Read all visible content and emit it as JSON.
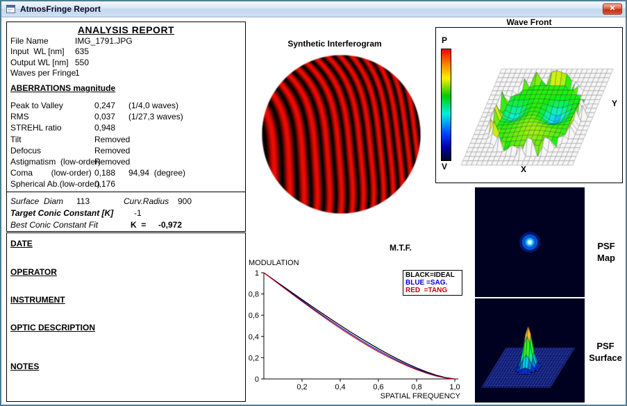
{
  "window": {
    "title": "AtmosFringe  Report",
    "close_glyph": "✕"
  },
  "report": {
    "title": "ANALYSIS  REPORT",
    "fields": [
      {
        "label": "File Name",
        "value": "IMG_1791.JPG"
      },
      {
        "label": "Input  WL [nm]",
        "value": "635"
      },
      {
        "label": "Output WL [nm]",
        "value": "550"
      },
      {
        "label": "Waves per Fringe",
        "value": "1"
      }
    ],
    "aberrations_heading": "ABERRATIONS magnitude",
    "aberrations": [
      {
        "label": "Peak to Valley",
        "value": "0,247",
        "extra": "(1/4,0 waves)"
      },
      {
        "label": "RMS",
        "value": "0,037",
        "extra": "(1/27,3 waves)"
      },
      {
        "label": "STREHL ratio",
        "value": "0,948",
        "extra": ""
      },
      {
        "label": "Tilt",
        "value": "Removed",
        "extra": ""
      },
      {
        "label": "Defocus",
        "value": "Removed",
        "extra": ""
      },
      {
        "label": "Astigmatism  (low-order)",
        "value": "Removed",
        "extra": ""
      },
      {
        "label": "Coma        (low-order)",
        "value": "0,188",
        "extra": "94,94  (degree)"
      },
      {
        "label": "Spherical Ab.(low-order)",
        "value": "0,176",
        "extra": ""
      }
    ],
    "surface": {
      "diam_label": "Surface  Diam",
      "diam_value": "113",
      "curv_label": "Curv.Radius",
      "curv_value": "900",
      "target_label": "Target Conic Constant [K]",
      "target_value": "-1",
      "fit_label": "Best Conic Constant Fit",
      "fit_k": "K  =",
      "fit_value": "-0,972"
    }
  },
  "form": {
    "sections": [
      "DATE",
      "OPERATOR",
      "INSTRUMENT",
      "OPTIC DESCRIPTION",
      "NOTES"
    ]
  },
  "panels": {
    "interferogram_title": "Synthetic Interferogram",
    "wavefront": {
      "title": "Wave Front",
      "top_label": "P",
      "bottom_label": "V",
      "x_label": "X",
      "y_label": "Y"
    },
    "psf_map": {
      "line1": "PSF",
      "line2": "Map"
    },
    "psf_surface": {
      "line1": "PSF",
      "line2": "Surface"
    }
  },
  "chart_data": {
    "type": "line",
    "title": "M.T.F.",
    "xlabel": "SPATIAL FREQUENCY",
    "ylabel": "MODULATION",
    "xlim": [
      0,
      1
    ],
    "ylim": [
      0,
      1
    ],
    "grid": false,
    "legend_position": "top-right",
    "legend": [
      "BLACK=IDEAL",
      "BLUE =SAG.",
      "RED  =TANG"
    ],
    "x_ticks": [
      0.2,
      0.4,
      0.6,
      0.8,
      1.0
    ],
    "x_tick_labels": [
      "0,2",
      "0,4",
      "0,6",
      "0,8",
      "1,0"
    ],
    "y_ticks": [
      0,
      0.2,
      0.4,
      0.6,
      0.8,
      1
    ],
    "y_tick_labels": [
      "0",
      "0,2",
      "0,4",
      "0,6",
      "0,8",
      "1"
    ],
    "x": [
      0,
      0.05,
      0.1,
      0.15,
      0.2,
      0.25,
      0.3,
      0.35,
      0.4,
      0.45,
      0.5,
      0.55,
      0.6,
      0.65,
      0.7,
      0.75,
      0.8,
      0.85,
      0.9,
      0.95,
      1
    ],
    "series": [
      {
        "name": "IDEAL",
        "color": "#000000",
        "values": [
          1,
          0.936,
          0.873,
          0.81,
          0.747,
          0.685,
          0.624,
          0.564,
          0.505,
          0.447,
          0.391,
          0.337,
          0.285,
          0.235,
          0.188,
          0.144,
          0.104,
          0.068,
          0.037,
          0.013,
          0
        ]
      },
      {
        "name": "SAG.",
        "color": "#0000c8",
        "values": [
          1,
          0.934,
          0.867,
          0.802,
          0.737,
          0.672,
          0.609,
          0.548,
          0.488,
          0.429,
          0.373,
          0.319,
          0.268,
          0.219,
          0.174,
          0.132,
          0.094,
          0.06,
          0.032,
          0.011,
          0
        ]
      },
      {
        "name": "TANG",
        "color": "#c80000",
        "values": [
          1,
          0.932,
          0.864,
          0.796,
          0.73,
          0.664,
          0.6,
          0.537,
          0.476,
          0.417,
          0.361,
          0.307,
          0.256,
          0.208,
          0.164,
          0.123,
          0.087,
          0.055,
          0.028,
          0.009,
          0
        ]
      }
    ]
  },
  "colors": {
    "fringe_red": "#e00000",
    "psf_background": "#000020",
    "wavefront_grid_gray": "#9a9a9a"
  }
}
